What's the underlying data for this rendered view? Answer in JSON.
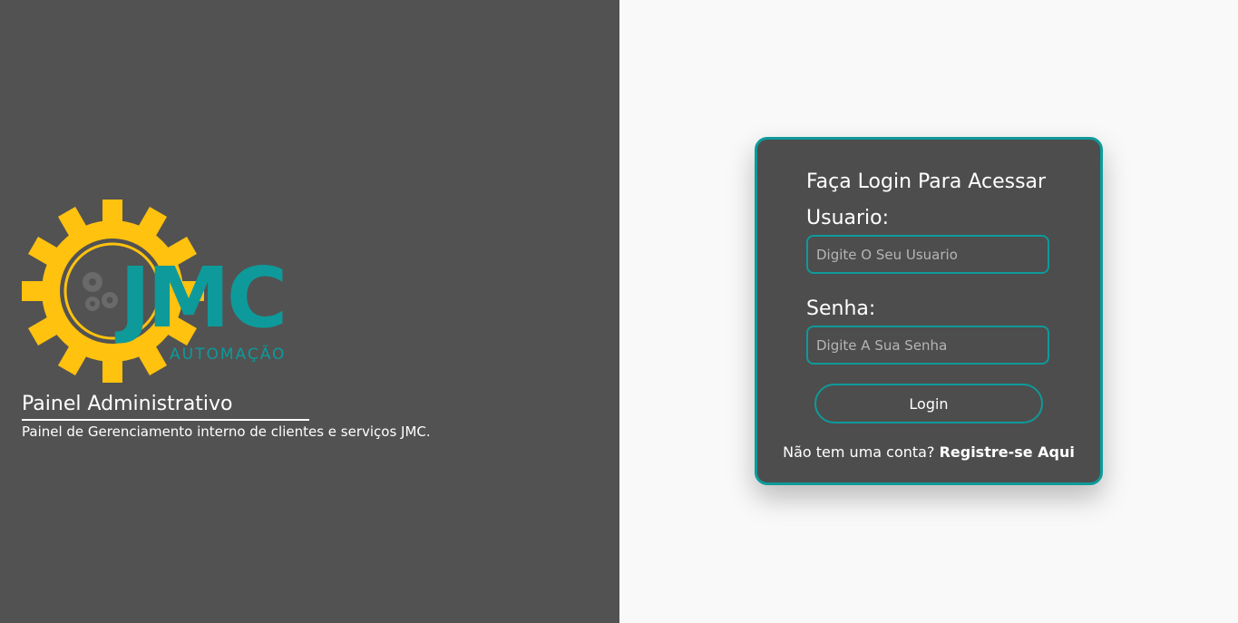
{
  "brand": {
    "logo_text": "JMC",
    "logo_subtext": "AUTOMAÇÃO",
    "colors": {
      "gear": "#ffc20e",
      "teal": "#0e9a9a",
      "dark": "#525252"
    }
  },
  "left_panel": {
    "title": "Painel Administrativo",
    "description": "Painel de Gerenciamento interno de clientes e serviços JMC."
  },
  "login_card": {
    "title": "Faça Login Para Acessar",
    "username_label": "Usuario:",
    "username_placeholder": "Digite O Seu Usuario",
    "username_value": "",
    "password_label": "Senha:",
    "password_placeholder": "Digite A Sua Senha",
    "password_value": "",
    "login_button_label": "Login",
    "register_prompt": "Não tem uma conta?",
    "register_link_label": "Registre-se Aqui"
  }
}
